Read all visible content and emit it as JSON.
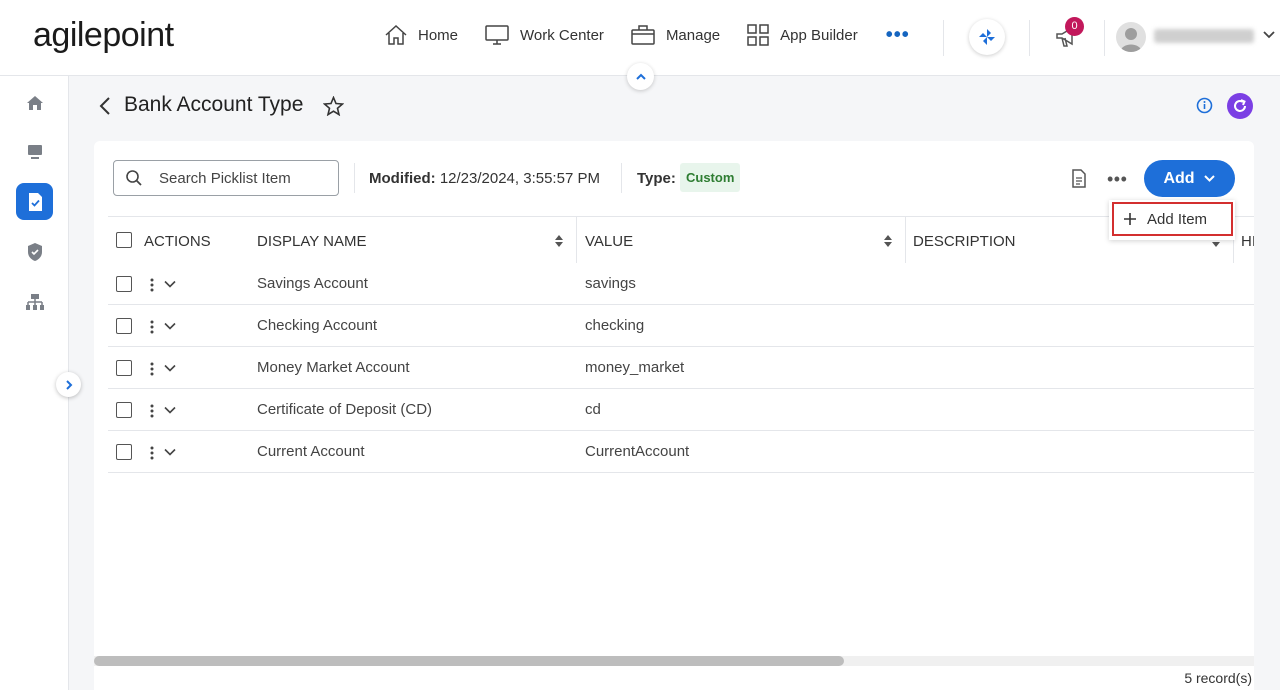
{
  "app": {
    "logo": "agilepoint"
  },
  "nav": {
    "items": [
      {
        "label": "Home",
        "icon": "home-icon"
      },
      {
        "label": "Work Center",
        "icon": "monitor-icon"
      },
      {
        "label": "Manage",
        "icon": "briefcase-icon"
      },
      {
        "label": "App Builder",
        "icon": "grid-icon"
      }
    ],
    "more": "•••",
    "notifications_count": "0"
  },
  "page": {
    "title": "Bank Account Type"
  },
  "toolbar": {
    "search_placeholder": "Search Picklist Item",
    "modified_label": "Modified:",
    "modified_value": "12/23/2024, 3:55:57 PM",
    "type_label": "Type:",
    "type_value": "Custom",
    "add_label": "Add",
    "add_menu": {
      "add_item": "Add Item"
    }
  },
  "table": {
    "columns": [
      "ACTIONS",
      "DISPLAY NAME",
      "VALUE",
      "DESCRIPTION",
      "HI"
    ],
    "rows": [
      {
        "display_name": "Savings Account",
        "value": "savings",
        "description": ""
      },
      {
        "display_name": "Checking Account",
        "value": "checking",
        "description": ""
      },
      {
        "display_name": "Money Market Account",
        "value": "money_market",
        "description": ""
      },
      {
        "display_name": "Certificate of Deposit (CD)",
        "value": "cd",
        "description": ""
      },
      {
        "display_name": "Current Account",
        "value": "CurrentAccount",
        "description": ""
      }
    ]
  },
  "footer": {
    "records": "5 record(s)"
  },
  "colors": {
    "primary": "#1e6fd9",
    "badge": "#c2185b",
    "refresh": "#7b3fe4",
    "custom_badge_bg": "#e8f5ec",
    "custom_badge_text": "#2e7d32"
  }
}
